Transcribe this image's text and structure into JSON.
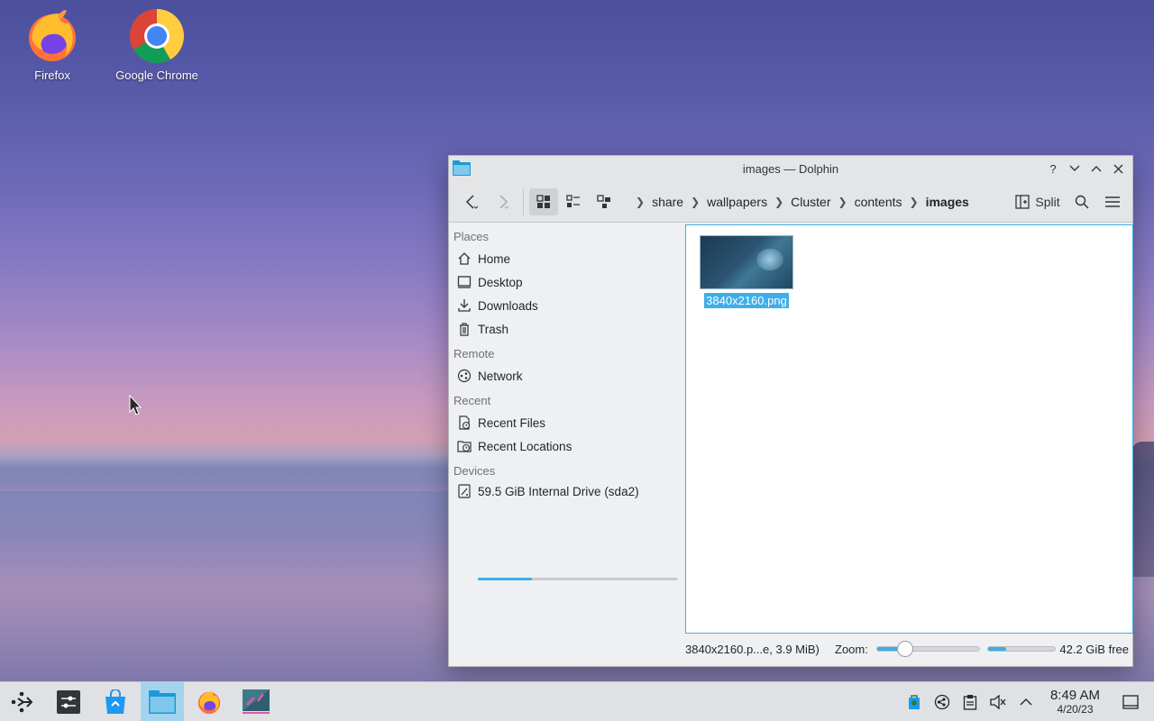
{
  "desktop": {
    "icons": [
      {
        "label": "Firefox"
      },
      {
        "label": "Google Chrome"
      }
    ]
  },
  "window": {
    "title": "images — Dolphin",
    "controls": {
      "help": "?",
      "minimize": "⌄",
      "maximize": "⌃",
      "close": "✕"
    }
  },
  "toolbar": {
    "breadcrumbs": [
      "share",
      "wallpapers",
      "Cluster",
      "contents",
      "images"
    ],
    "split_label": "Split"
  },
  "sidebar": {
    "places_heading": "Places",
    "places": [
      {
        "label": "Home",
        "icon": "home-icon"
      },
      {
        "label": "Desktop",
        "icon": "desktop-icon"
      },
      {
        "label": "Downloads",
        "icon": "downloads-icon"
      },
      {
        "label": "Trash",
        "icon": "trash-icon"
      }
    ],
    "remote_heading": "Remote",
    "remote": [
      {
        "label": "Network",
        "icon": "network-icon"
      }
    ],
    "recent_heading": "Recent",
    "recent": [
      {
        "label": "Recent Files",
        "icon": "recent-files-icon"
      },
      {
        "label": "Recent Locations",
        "icon": "recent-locations-icon"
      }
    ],
    "devices_heading": "Devices",
    "devices": [
      {
        "label": "59.5 GiB Internal Drive (sda2)",
        "icon": "drive-icon",
        "usage_fraction": 0.27
      }
    ]
  },
  "content": {
    "files": [
      {
        "name": "3840x2160.png",
        "selected": true
      }
    ]
  },
  "statusbar": {
    "selection_info": "3840x2160.p...e, 3.9 MiB)",
    "zoom_label": "Zoom:",
    "zoom_fraction": 0.28,
    "space_used_fraction": 0.27,
    "free_space": "42.2 GiB free"
  },
  "taskbar": {
    "tasks": [
      {
        "name": "application-launcher-icon"
      },
      {
        "name": "system-settings-icon"
      },
      {
        "name": "discover-store-icon"
      },
      {
        "name": "dolphin-file-manager-icon",
        "active": true
      },
      {
        "name": "firefox-icon"
      },
      {
        "name": "screenshot-tool-icon"
      }
    ],
    "clock": {
      "time": "8:49 AM",
      "date": "4/20/23"
    }
  },
  "colors": {
    "accent": "#3daee9",
    "selection": "#3daee9",
    "window_bg": "#eff0f1"
  }
}
